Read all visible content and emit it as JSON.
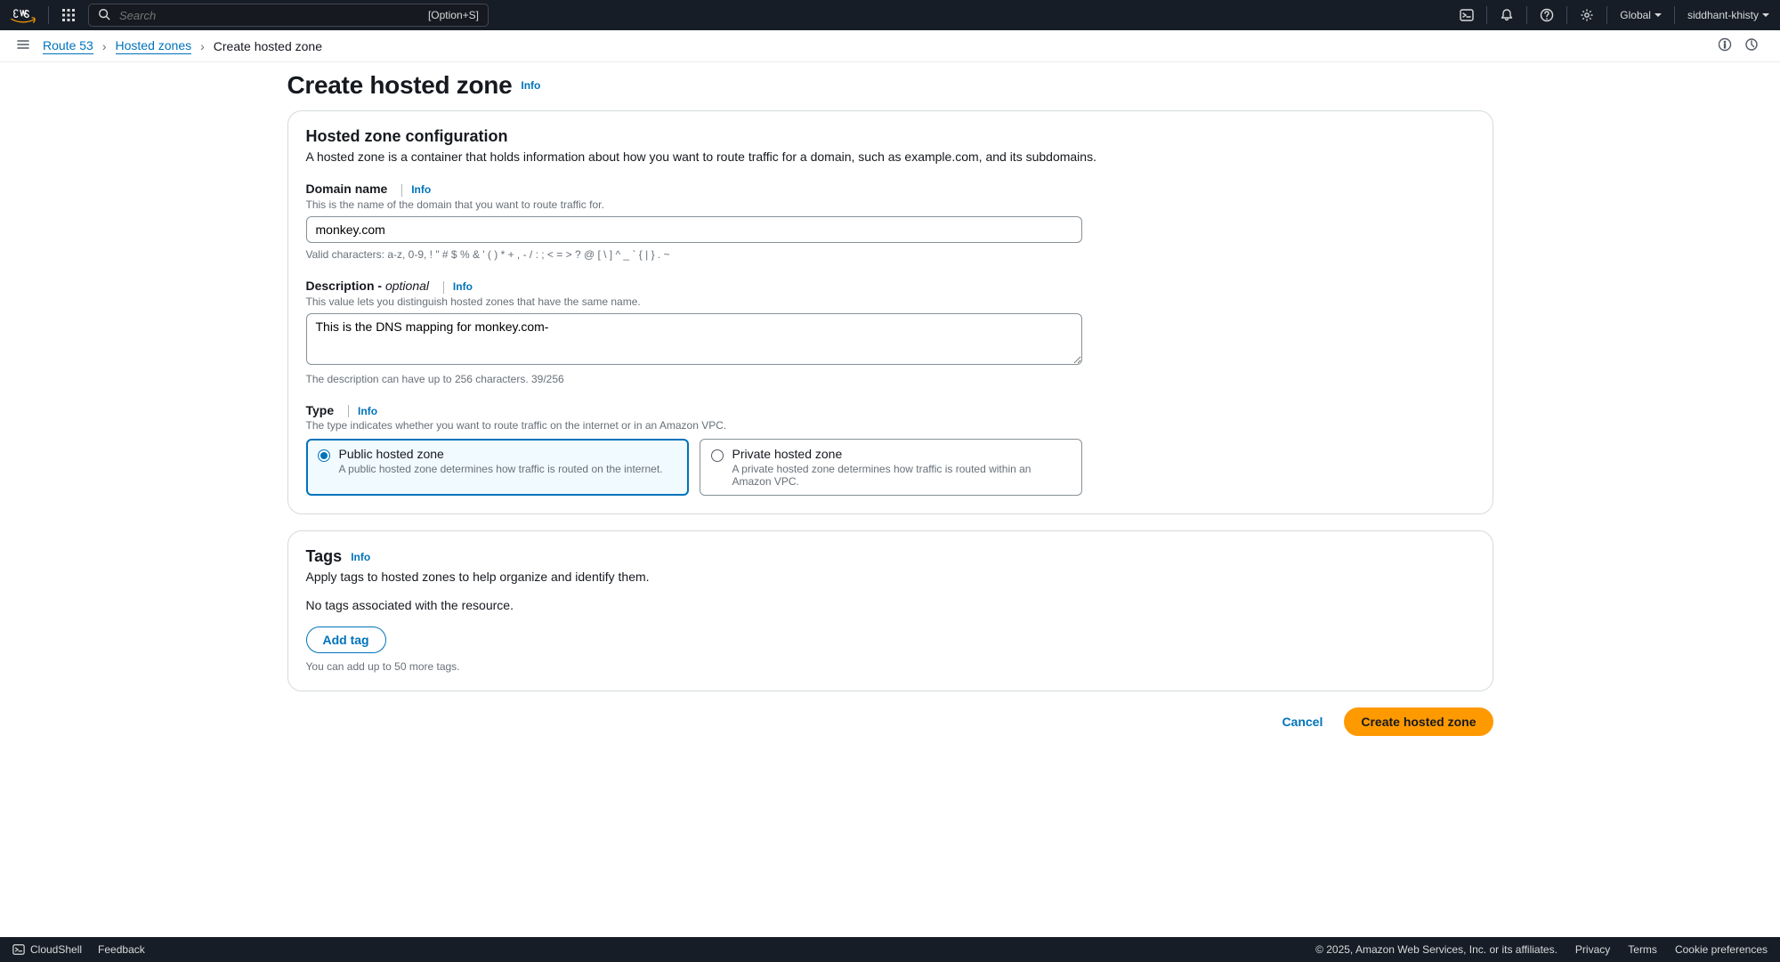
{
  "topnav": {
    "search_placeholder": "Search",
    "search_shortcut": "[Option+S]",
    "region": "Global",
    "username": "siddhant-khisty"
  },
  "breadcrumb": {
    "service": "Route 53",
    "parent": "Hosted zones",
    "current": "Create hosted zone"
  },
  "page": {
    "title": "Create hosted zone",
    "title_info": "Info"
  },
  "config_panel": {
    "heading": "Hosted zone configuration",
    "description": "A hosted zone is a container that holds information about how you want to route traffic for a domain, such as example.com, and its subdomains.",
    "domain_name": {
      "label": "Domain name",
      "info": "Info",
      "hint": "This is the name of the domain that you want to route traffic for.",
      "value": "monkey.com",
      "constraint": "Valid characters: a-z, 0-9, ! \" # $ % & ' ( ) * + , - / : ; < = > ? @ [ \\ ] ^ _ ` { | } . ~"
    },
    "description_field": {
      "label_prefix": "Description - ",
      "label_optional": "optional",
      "info": "Info",
      "hint": "This value lets you distinguish hosted zones that have the same name.",
      "value": "This is the DNS mapping for monkey.com-",
      "constraint": "The description can have up to 256 characters. 39/256"
    },
    "type": {
      "label": "Type",
      "info": "Info",
      "hint": "The type indicates whether you want to route traffic on the internet or in an Amazon VPC.",
      "public": {
        "title": "Public hosted zone",
        "desc": "A public hosted zone determines how traffic is routed on the internet."
      },
      "private": {
        "title": "Private hosted zone",
        "desc": "A private hosted zone determines how traffic is routed within an Amazon VPC."
      }
    }
  },
  "tags_panel": {
    "heading": "Tags",
    "info": "Info",
    "description": "Apply tags to hosted zones to help organize and identify them.",
    "empty_message": "No tags associated with the resource.",
    "add_button": "Add tag",
    "constraint": "You can add up to 50 more tags."
  },
  "actions": {
    "cancel": "Cancel",
    "submit": "Create hosted zone"
  },
  "footer": {
    "cloudshell": "CloudShell",
    "feedback": "Feedback",
    "copyright": "© 2025, Amazon Web Services, Inc. or its affiliates.",
    "privacy": "Privacy",
    "terms": "Terms",
    "cookies": "Cookie preferences"
  }
}
